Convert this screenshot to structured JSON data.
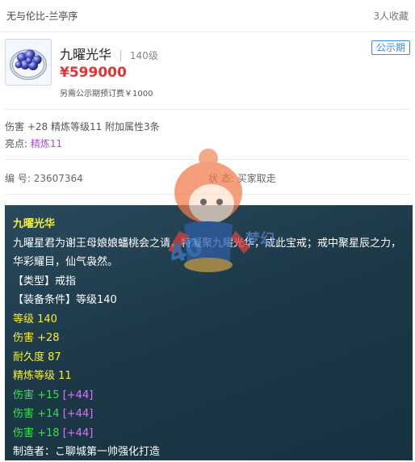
{
  "header": {
    "server": "无与伦比-兰亭序",
    "favorites": "3人收藏"
  },
  "item": {
    "name": "九曜光华",
    "level": "140级",
    "price": "¥599000",
    "extra_fee": "另需公示期预订费￥1000",
    "badge": "公示期"
  },
  "summary": {
    "attrs": "伤害 +28 精炼等级11 附加属性3条",
    "highlight_label": "亮点:",
    "highlight_value": "精炼11"
  },
  "meta": {
    "id_label": "编 号:",
    "id_value": "23607364",
    "status_label": "状 态:",
    "status_value": "买家取走"
  },
  "detail": {
    "title": "九曜光华",
    "description": "九曜星君为谢王母娘娘蟠桃会之请，特凝聚九曜光华，成此宝戒；戒中聚星辰之力，华彩耀目，仙气袅然。",
    "type": "【类型】戒指",
    "requirement": "【装备条件】等级140",
    "stats": [
      "等级 140",
      "伤害 +28",
      "耐久度 87",
      "精炼等级 11"
    ],
    "added": [
      {
        "text": "伤害 +15",
        "bonus": "[+44]"
      },
      {
        "text": "伤害 +14",
        "bonus": "[+44]"
      },
      {
        "text": "伤害 +18",
        "bonus": "[+44]"
      }
    ],
    "maker": "制造者：こ聊城第一帅强化打造"
  },
  "watermark_text": "梦幻",
  "colors": {
    "price": "#e8322f",
    "badge": "#3b8bd6",
    "highlight": "#b04bd6",
    "panel_bg": "#1d3948",
    "title_yellow": "#f7ee3a",
    "green": "#39e048",
    "purple": "#e070ff"
  },
  "icons": [
    "ring-item-icon",
    "mascot-watermark-icon"
  ]
}
